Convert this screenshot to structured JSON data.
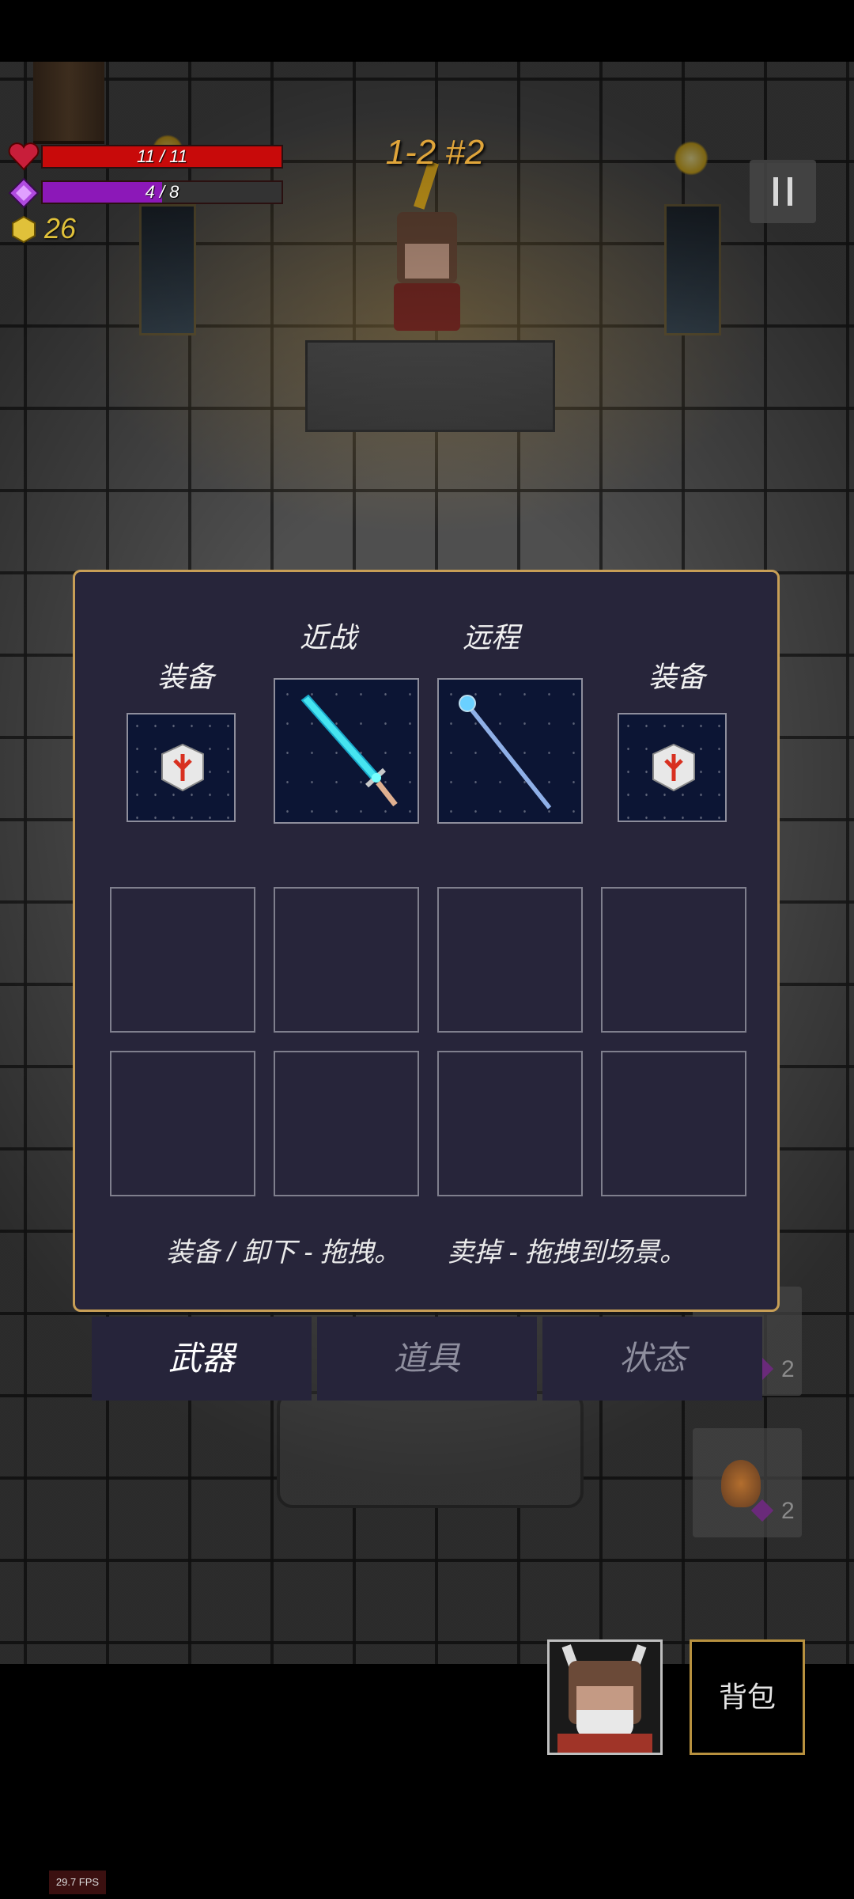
{
  "hud": {
    "health_text": "11 / 11",
    "health_fraction": 1.0,
    "mana_text": "4 / 8",
    "mana_fraction": 0.5,
    "gold": "26",
    "level": "1-2 #2",
    "colors": {
      "health": "#c80a0a",
      "mana": "#8c18b8",
      "gold": "#e0c13a",
      "accent": "#e0a53a"
    }
  },
  "panel": {
    "melee_label": "近战",
    "ranged_label": "远程",
    "equip_left_label": "装备",
    "equip_right_label": "装备",
    "equip_left_icon": "rune-cube-icon",
    "equip_right_icon": "rune-cube-icon",
    "melee_icon": "cyan-sword-icon",
    "ranged_icon": "ice-staff-icon",
    "hint_equip": "装备 / 卸下 - 拖拽。",
    "hint_sell": "卖掉 - 拖拽到场景。"
  },
  "tabs": [
    {
      "label": "武器",
      "active": true
    },
    {
      "label": "道具",
      "active": false
    },
    {
      "label": "状态",
      "active": false
    }
  ],
  "side_items": [
    {
      "count": "2",
      "icon": "mana-gem-icon"
    },
    {
      "count": "2",
      "icon": "fire-potion-icon"
    }
  ],
  "bottom": {
    "bag_label": "背包",
    "portrait_icon": "hero-portrait-icon"
  },
  "fps": "29.7 FPS"
}
